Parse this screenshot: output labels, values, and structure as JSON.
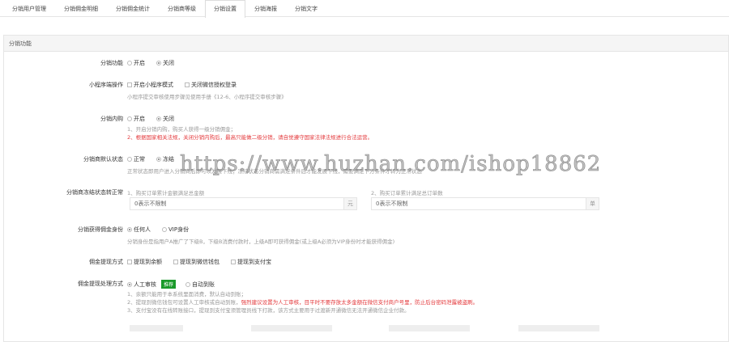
{
  "tabs": [
    "分销用户管理",
    "分销佣金明细",
    "分销佣金统计",
    "分销商等级",
    "分销设置",
    "分销海报",
    "分销文字"
  ],
  "active_tab": 4,
  "panel_title": "分销功能",
  "rows": {
    "enable": {
      "label": "分销功能",
      "options": [
        "开启",
        "关闭"
      ],
      "selected": 1
    },
    "miniapp": {
      "label": "小程序端操作",
      "options": [
        "开启小程序模式",
        "关闭微信授权登录"
      ],
      "help": "小程序提交审核使用步骤见使用手册《12-6、小程序提交审核步骤》"
    },
    "inner": {
      "label": "分销内购",
      "options": [
        "开启",
        "关闭"
      ],
      "selected": 1,
      "help1": "1、开启分销内购，购买人获得一级分销佣金；",
      "help2": "2、根据国家相关法规，关闭分销内购后，最高只能做二级分销，请自觉遵守国家法律法规进行合法运营。"
    },
    "default_status": {
      "label": "分销商默认状态",
      "options": [
        "正常",
        "冻结"
      ],
      "selected": 1,
      "help": "正常状态即用户进入分销商后即可以发展下线；冻结状态分销商需满足条件后才能发展下线，需要满足下方条件才转为正常状态"
    },
    "unfreeze": {
      "label": "分销商冻结状态转正常",
      "sub1": "1、购买订单累计金额满足总金额",
      "sub2": "2、购买订单累计满足总订单数",
      "placeholder": "0表示不限制",
      "unit1": "元",
      "unit2": "单"
    },
    "identity": {
      "label": "分销获得佣金身份",
      "options": [
        "任何人",
        "VIP身份"
      ],
      "selected": 0,
      "help": "分销身份是指用户A推广了下级B，下级B消费付款时，上级A即可获得佣金(或上级A必须为VIP身份时才能获得佣金)"
    },
    "withdraw": {
      "label": "佣金提现方式",
      "options": [
        "提现到余额",
        "提现到微信钱包",
        "提现到支付宝"
      ]
    },
    "process": {
      "label": "佣金提现处理方式",
      "options": [
        "人工审核",
        "自动到账"
      ],
      "selected": 0,
      "badge": "推荐",
      "help1": "1、余额只能用于本系统里面消费，默认自动到账；",
      "help2a": "2、提现到微信钱包可设置人工审核或自动到账，",
      "help2b": "强烈建议设置为人工审核，目平时不要存放太多金额在微信支付商户号里，防止后台密码泄露被盗刷。",
      "help3": "3、支付宝没有在线转账接口，提现到支付宝须管理员线下打款，该方式主要用于过渡新开通微信无法开通微信企业付款。"
    }
  },
  "watermark": "https://www.huzhan.com/ishop18862"
}
